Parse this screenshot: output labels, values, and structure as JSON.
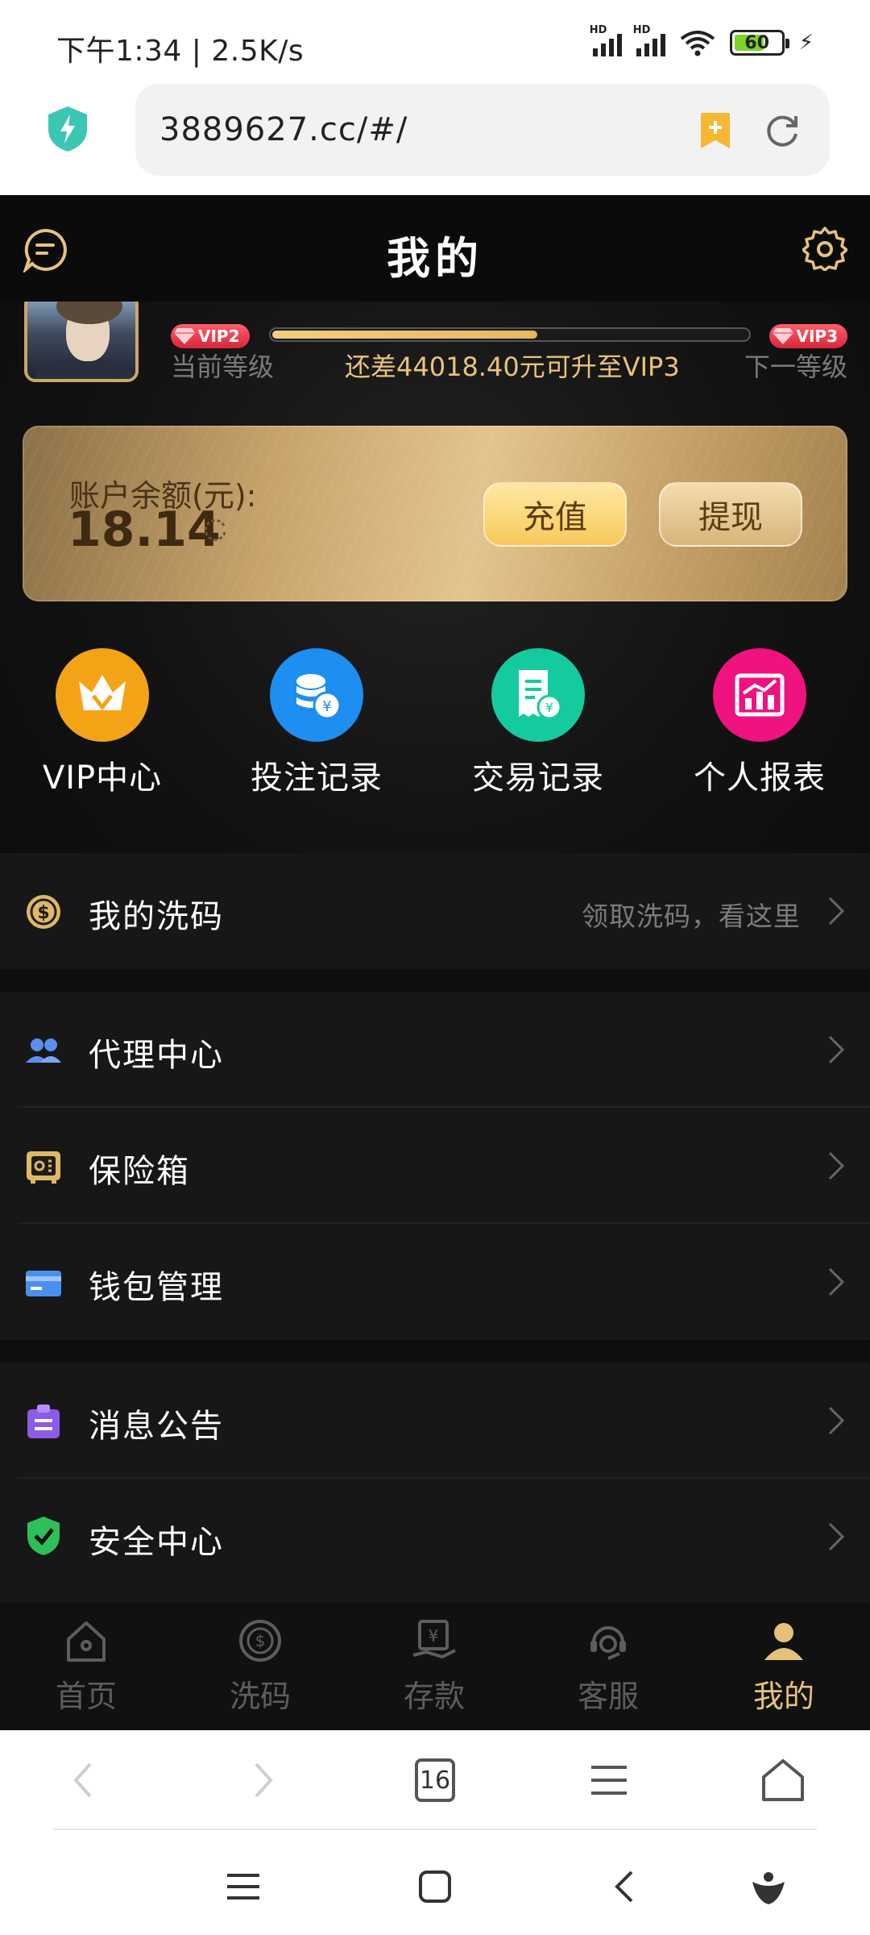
{
  "status": {
    "time_speed": "下午1:34 | 2.5K/s",
    "battery": "60",
    "signal_label": "HD"
  },
  "browser": {
    "url": "3889627.cc/#/",
    "tab_count": "16"
  },
  "header": {
    "title": "我的"
  },
  "vip": {
    "current_badge": "VIP2",
    "next_badge": "VIP3",
    "current_label": "当前等级",
    "next_label": "下一等级",
    "progress_note": "还差44018.40元可升至VIP3",
    "progress": 0.56
  },
  "balance": {
    "label": "账户余额(元):",
    "value": "18.14",
    "recharge_label": "充值",
    "withdraw_label": "提现"
  },
  "quick": [
    {
      "label": "VIP中心",
      "color": "#f5a316",
      "icon": "crown-icon"
    },
    {
      "label": "投注记录",
      "color": "#1e8ff0",
      "icon": "coins-icon"
    },
    {
      "label": "交易记录",
      "color": "#14cba0",
      "icon": "receipt-icon"
    },
    {
      "label": "个人报表",
      "color": "#f0127e",
      "icon": "chart-icon"
    }
  ],
  "menu": {
    "rebate": {
      "label": "我的洗码",
      "hint": "领取洗码，看这里"
    },
    "agent": {
      "label": "代理中心"
    },
    "safe": {
      "label": "保险箱"
    },
    "wallet": {
      "label": "钱包管理"
    },
    "notice": {
      "label": "消息公告"
    },
    "security": {
      "label": "安全中心"
    }
  },
  "nav": {
    "home": "首页",
    "rebate": "洗码",
    "deposit": "存款",
    "service": "客服",
    "mine": "我的"
  },
  "colors": {
    "accent": "#e5c27a",
    "background": "#0e0e0e",
    "panel": "#171717"
  }
}
